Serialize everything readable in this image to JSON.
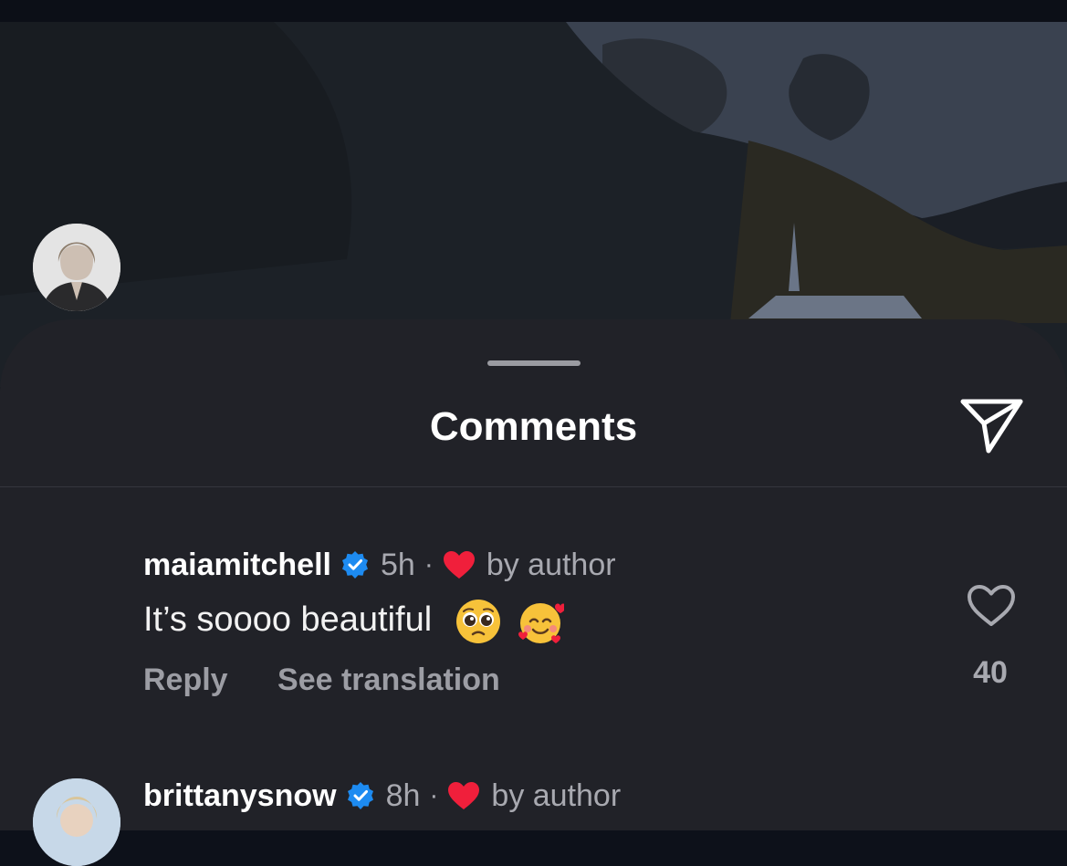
{
  "sheet": {
    "title": "Comments"
  },
  "comments": [
    {
      "username": "maiamitchell",
      "time": "5h",
      "separator": "·",
      "author_label": "by author",
      "text": "It’s soooo beautiful",
      "emojis": [
        "pleading-face",
        "smiling-face-with-hearts"
      ],
      "reply_label": "Reply",
      "translate_label": "See translation",
      "likes": "40"
    },
    {
      "username": "brittanysnow",
      "time": "8h",
      "separator": "·",
      "author_label": "by author"
    }
  ],
  "icons": {
    "share": "paper-plane-icon",
    "verified": "verified-badge-icon",
    "author_heart": "heart-filled-icon",
    "like": "heart-outline-icon"
  },
  "colors": {
    "sheet_bg": "#212228",
    "verified_blue": "#1d8bf1",
    "heart_red": "#f01f3b",
    "muted_text": "#a8a9b0"
  }
}
